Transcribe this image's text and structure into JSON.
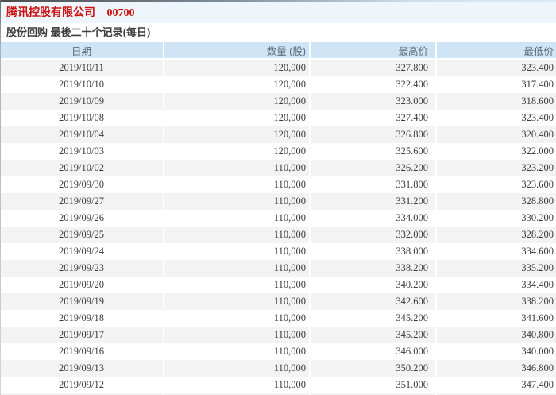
{
  "page": {
    "company_name": "腾讯控股有限公司",
    "stock_code": "00700",
    "subtitle": "股份回购 最後二十个记录(每日)"
  },
  "table": {
    "columns": [
      {
        "key": "date",
        "label": "日期"
      },
      {
        "key": "qty",
        "label": "数量 (股)"
      },
      {
        "key": "high",
        "label": "最高价"
      },
      {
        "key": "low",
        "label": "最低价"
      }
    ],
    "rows": [
      {
        "date": "2019/10/11",
        "qty": "120,000",
        "high": "327.800",
        "low": "323.400"
      },
      {
        "date": "2019/10/10",
        "qty": "120,000",
        "high": "322.400",
        "low": "317.400"
      },
      {
        "date": "2019/10/09",
        "qty": "120,000",
        "high": "323.000",
        "low": "318.600"
      },
      {
        "date": "2019/10/08",
        "qty": "120,000",
        "high": "327.400",
        "low": "323.400"
      },
      {
        "date": "2019/10/04",
        "qty": "120,000",
        "high": "326.800",
        "low": "320.400"
      },
      {
        "date": "2019/10/03",
        "qty": "120,000",
        "high": "325.600",
        "low": "322.000"
      },
      {
        "date": "2019/10/02",
        "qty": "110,000",
        "high": "326.200",
        "low": "323.200"
      },
      {
        "date": "2019/09/30",
        "qty": "110,000",
        "high": "331.800",
        "low": "323.600"
      },
      {
        "date": "2019/09/27",
        "qty": "110,000",
        "high": "331.200",
        "low": "328.800"
      },
      {
        "date": "2019/09/26",
        "qty": "110,000",
        "high": "334.000",
        "low": "330.200"
      },
      {
        "date": "2019/09/25",
        "qty": "110,000",
        "high": "332.000",
        "low": "328.200"
      },
      {
        "date": "2019/09/24",
        "qty": "110,000",
        "high": "338.000",
        "low": "334.600"
      },
      {
        "date": "2019/09/23",
        "qty": "110,000",
        "high": "338.200",
        "low": "335.200"
      },
      {
        "date": "2019/09/20",
        "qty": "110,000",
        "high": "340.200",
        "low": "334.400"
      },
      {
        "date": "2019/09/19",
        "qty": "110,000",
        "high": "342.600",
        "low": "338.200"
      },
      {
        "date": "2019/09/18",
        "qty": "110,000",
        "high": "345.200",
        "low": "341.600"
      },
      {
        "date": "2019/09/17",
        "qty": "110,000",
        "high": "345.200",
        "low": "340.800"
      },
      {
        "date": "2019/09/16",
        "qty": "110,000",
        "high": "346.000",
        "low": "340.000"
      },
      {
        "date": "2019/09/13",
        "qty": "110,000",
        "high": "350.200",
        "low": "346.800"
      },
      {
        "date": "2019/09/12",
        "qty": "110,000",
        "high": "351.000",
        "low": "347.400"
      }
    ]
  },
  "colors": {
    "title_red": "#cc1111",
    "header_bg": "#cfe4f5",
    "header_text": "#5b6b79",
    "row_stripe": "#f3f3f3",
    "title_band_bg": "#eff6fb"
  }
}
